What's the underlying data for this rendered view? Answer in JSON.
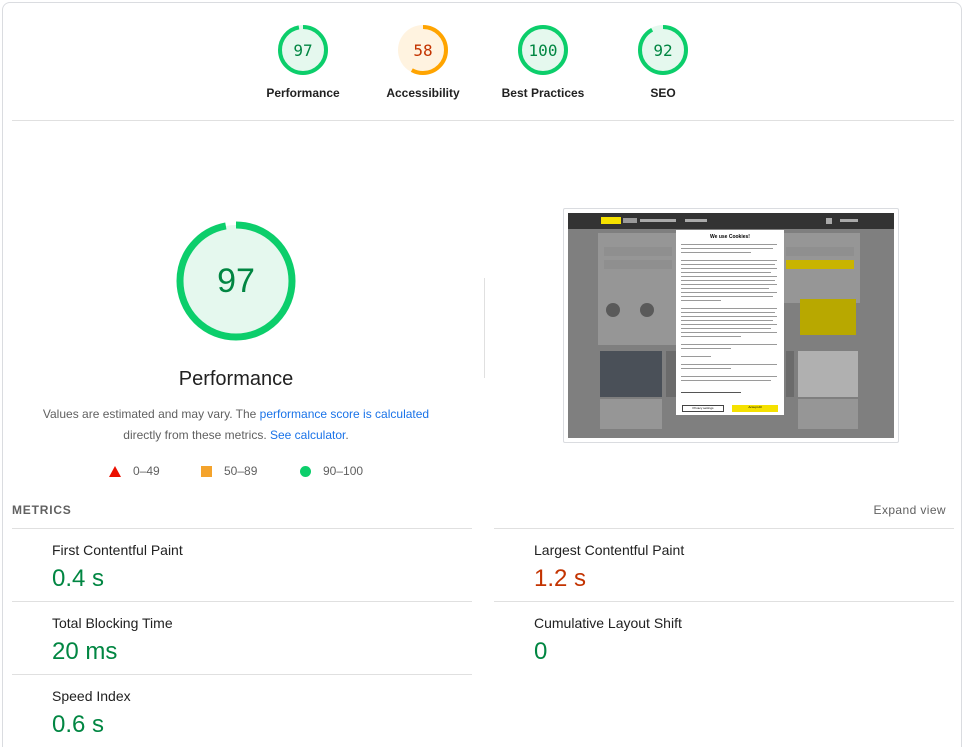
{
  "categories": [
    {
      "label": "Performance",
      "score": "97",
      "score_value": 97,
      "status": "pass"
    },
    {
      "label": "Accessibility",
      "score": "58",
      "score_value": 58,
      "status": "average"
    },
    {
      "label": "Best Practices",
      "score": "100",
      "score_value": 100,
      "status": "pass"
    },
    {
      "label": "SEO",
      "score": "92",
      "score_value": 92,
      "status": "pass"
    }
  ],
  "main": {
    "score": "97",
    "score_value": 97,
    "title": "Performance",
    "desc_text1": "Values are estimated and may vary. The ",
    "desc_link1": "performance score is calculated",
    "desc_text2": "directly from these metrics. ",
    "desc_link2": "See calculator",
    "desc_text3": "."
  },
  "legend": {
    "fail": "0–49",
    "average": "50–89",
    "pass": "90–100"
  },
  "screenshot": {
    "modal_title": "We use Cookies!",
    "privacy_settings_label": "Privacy settings",
    "accept_all_label": "Accept All"
  },
  "metrics": {
    "title": "METRICS",
    "expand_label": "Expand view",
    "items": [
      {
        "name": "First Contentful Paint",
        "value": "0.4 s",
        "status": "pass"
      },
      {
        "name": "Largest Contentful Paint",
        "value": "1.2 s",
        "status": "average"
      },
      {
        "name": "Total Blocking Time",
        "value": "20 ms",
        "status": "pass"
      },
      {
        "name": "Cumulative Layout Shift",
        "value": "0",
        "status": "pass"
      },
      {
        "name": "Speed Index",
        "value": "0.6 s",
        "status": "pass"
      }
    ]
  },
  "colors": {
    "pass": "#0cce6b",
    "pass_text": "#018642",
    "pass_bg": "#e5f8ee",
    "average": "#ffa400",
    "average_text": "#c33300",
    "average_bg": "#fff3e0",
    "fail": "#eb0f00",
    "link": "#1a73e8"
  }
}
